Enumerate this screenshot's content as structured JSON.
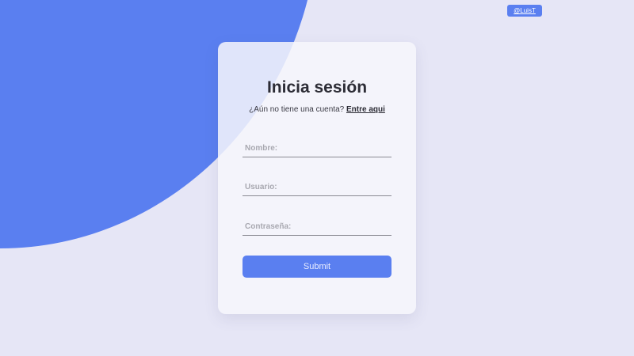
{
  "author_badge": "@LuisT",
  "form": {
    "title": "Inicia sesión",
    "subtitle_text": "¿Aún no tiene una cuenta? ",
    "signup_link": "Entre aqui",
    "fields": {
      "name": {
        "placeholder": "Nombre:",
        "value": ""
      },
      "user": {
        "placeholder": "Usuario:",
        "value": ""
      },
      "password": {
        "placeholder": "Contraseña:",
        "value": ""
      }
    },
    "submit_label": "Submit"
  },
  "colors": {
    "accent": "#5a7ff0",
    "background": "#e6e6f6",
    "card": "#f6f6fc"
  }
}
